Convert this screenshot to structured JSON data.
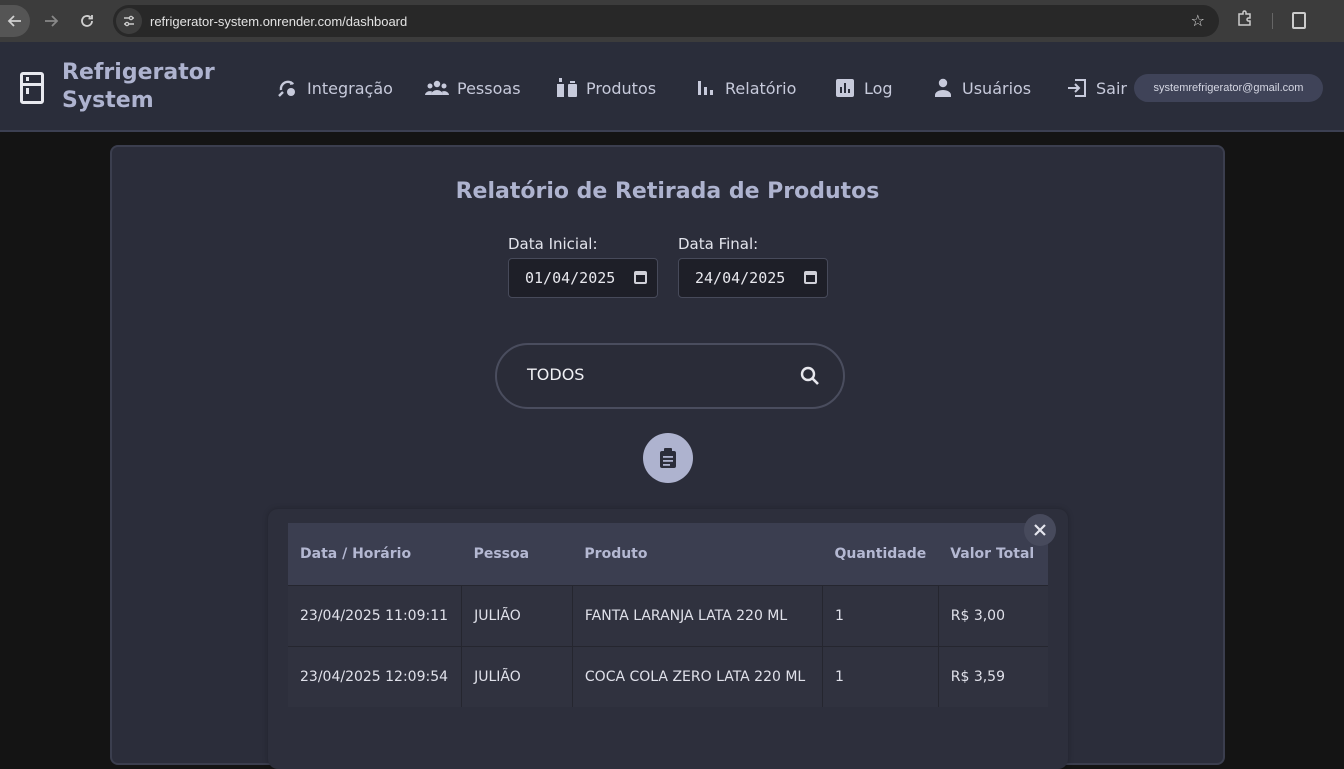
{
  "browser": {
    "url": "refrigerator-system.onrender.com/dashboard"
  },
  "header": {
    "brand_line1": "Refrigerator",
    "brand_line2": "System",
    "nav": [
      {
        "label": "Integração",
        "icon": "integration-icon"
      },
      {
        "label": "Pessoas",
        "icon": "people-icon"
      },
      {
        "label": "Produtos",
        "icon": "products-icon"
      },
      {
        "label": "Relatório",
        "icon": "report-chart-icon"
      },
      {
        "label": "Log",
        "icon": "log-icon"
      },
      {
        "label": "Usuários",
        "icon": "user-icon"
      },
      {
        "label": "Sair",
        "icon": "logout-icon"
      }
    ],
    "email": "systemrefrigerator@gmail.com"
  },
  "main": {
    "title": "Relatório de Retirada de Produtos",
    "start_date_label": "Data Inicial:",
    "start_date_value": "01/04/2025",
    "end_date_label": "Data Final:",
    "end_date_value": "24/04/2025",
    "search_value": "TODOS"
  },
  "table": {
    "columns": [
      "Data / Horário",
      "Pessoa",
      "Produto",
      "Quantidade",
      "Valor Total"
    ],
    "rows": [
      {
        "datetime": "23/04/2025 11:09:11",
        "person": "JULIÃO",
        "product": "FANTA LARANJA LATA 220 ML",
        "quantity": "1",
        "total": "R$ 3,00"
      },
      {
        "datetime": "23/04/2025 12:09:54",
        "person": "JULIÃO",
        "product": "COCA COLA ZERO LATA 220 ML",
        "quantity": "1",
        "total": "R$ 3,59"
      }
    ]
  },
  "colors": {
    "accent": "#aeb3cf",
    "header_bg": "#2a2d3a",
    "card_bg": "#2b2d3a",
    "page_bg": "#141414"
  }
}
